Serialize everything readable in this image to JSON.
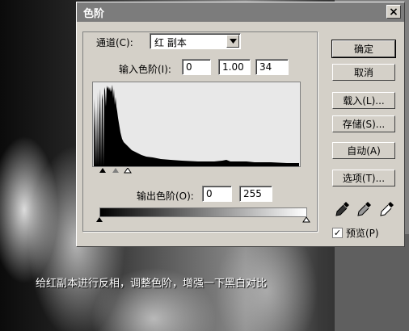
{
  "dialog": {
    "title": "色阶",
    "close_glyph": "×"
  },
  "channel": {
    "label": "通道(C):",
    "selected": "红 副本"
  },
  "input_levels": {
    "label": "输入色阶(I):",
    "black": "0",
    "gamma": "1.00",
    "white": "34"
  },
  "output_levels": {
    "label": "输出色阶(O):",
    "black": "0",
    "white": "255"
  },
  "buttons": {
    "ok": "确定",
    "cancel": "取消",
    "load": "载入(L)...",
    "save": "存储(S)...",
    "auto": "自动(A)",
    "options": "选项(T)..."
  },
  "preview": {
    "label": "预览(P)",
    "checked": true
  },
  "icons": {
    "black_eyedropper": "black-eyedropper-icon",
    "gray_eyedropper": "gray-eyedropper-icon",
    "white_eyedropper": "white-eyedropper-icon",
    "dropdown_arrow": "chevron-down-icon"
  },
  "caption": "给红副本进行反相，调整色阶，增强一下黑白对比",
  "colors": {
    "titlebar": "#7c7c7c",
    "dialog_face": "#d4d0c8",
    "histogram": "#000000"
  }
}
